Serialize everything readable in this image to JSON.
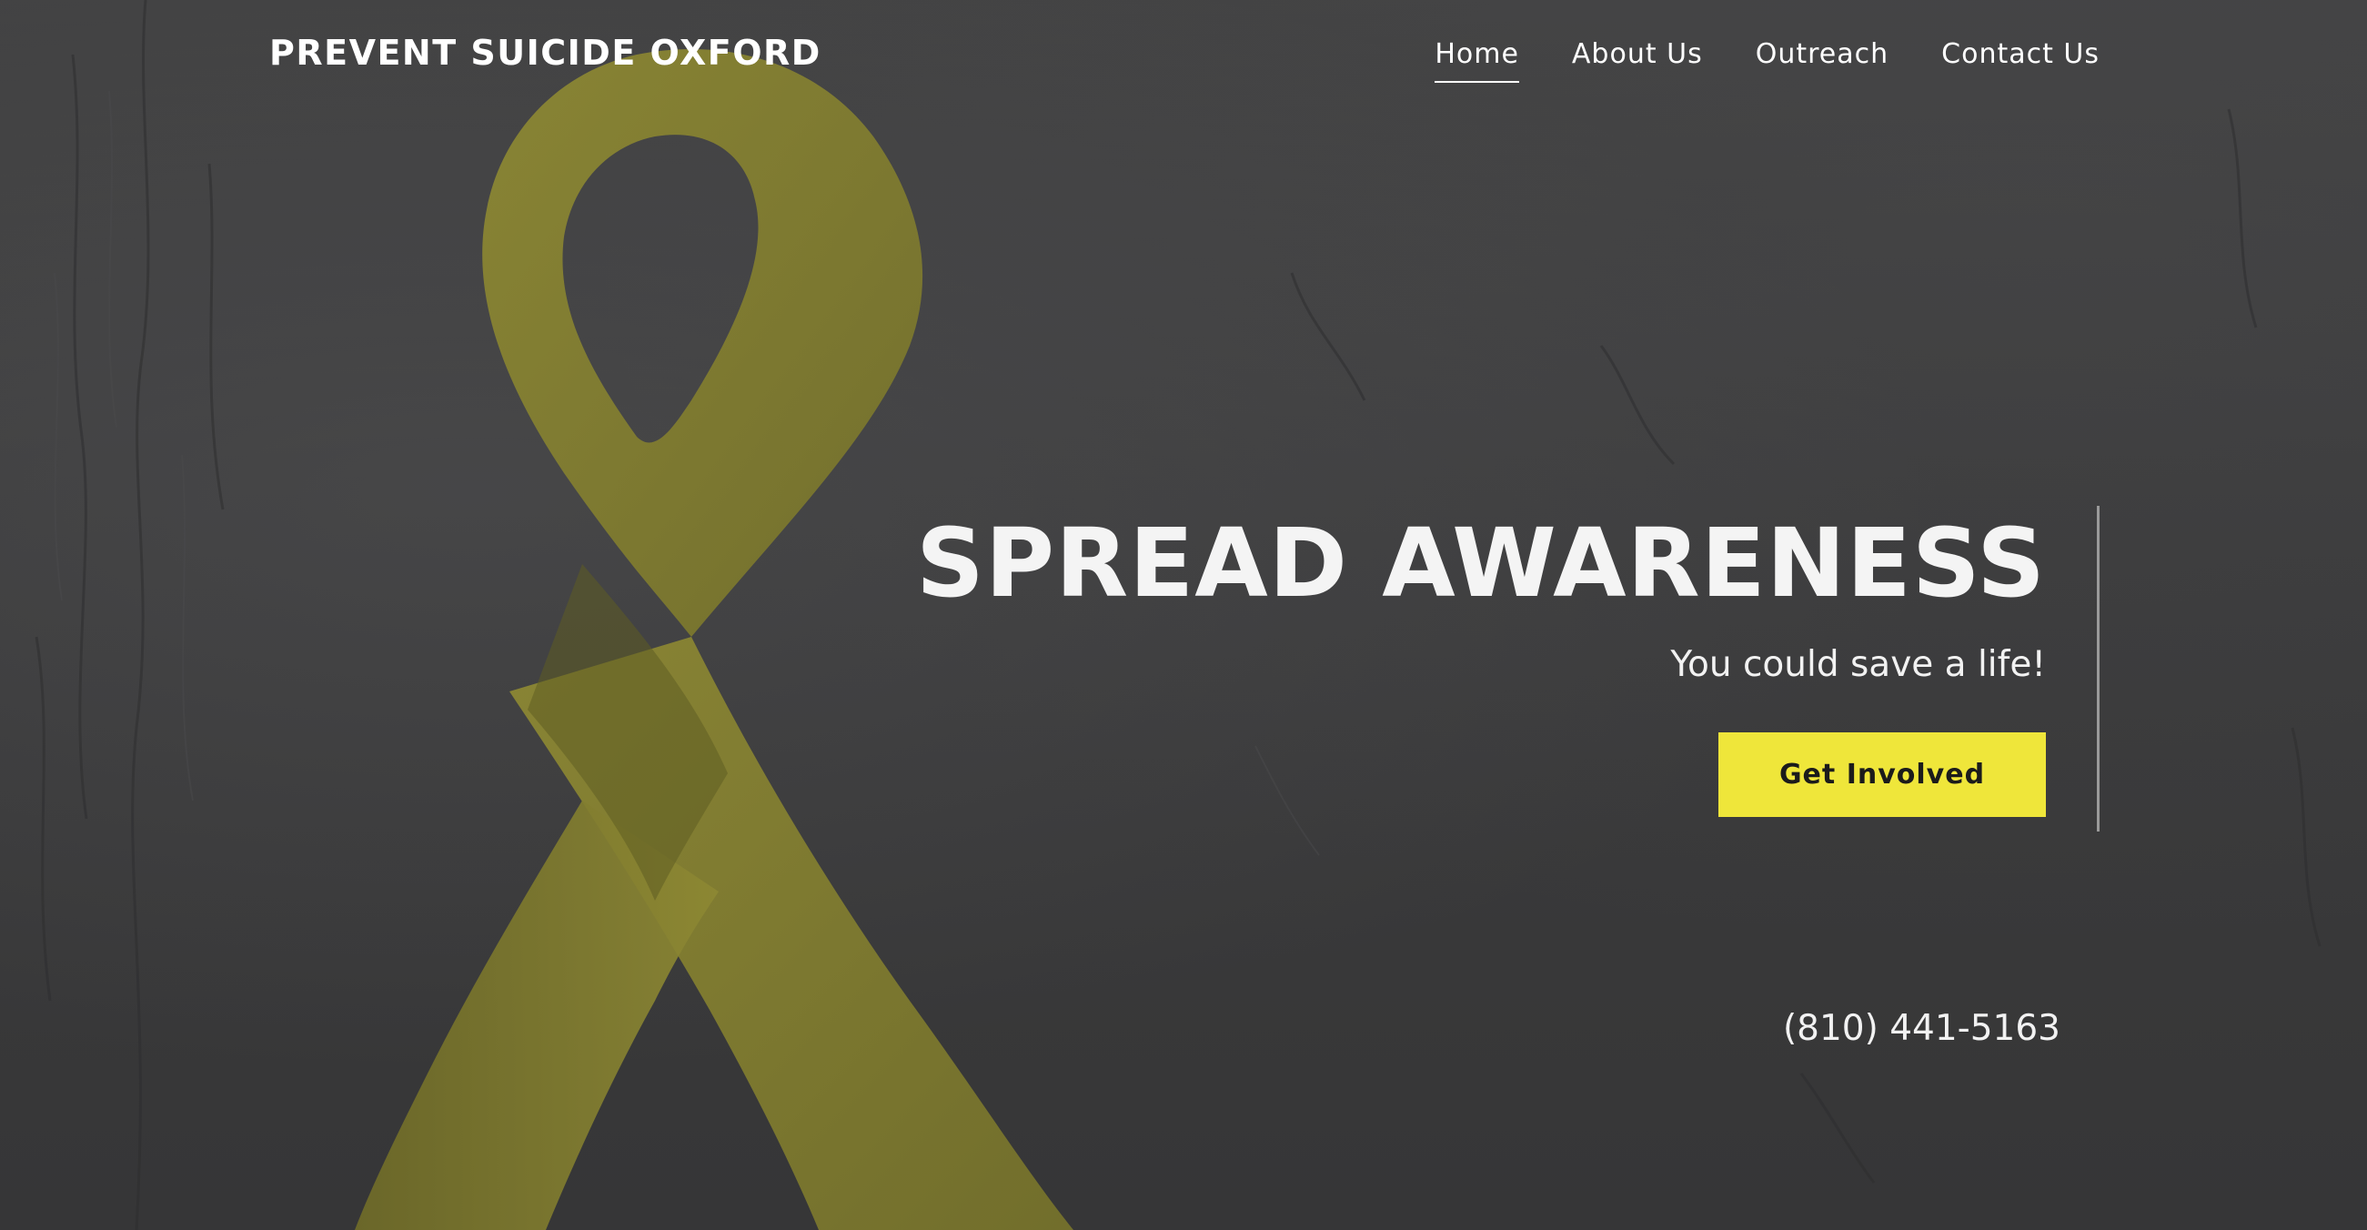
{
  "site": {
    "brand": "PREVENT SUICIDE OXFORD"
  },
  "nav": {
    "items": [
      {
        "label": "Home",
        "active": true
      },
      {
        "label": "About Us",
        "active": false
      },
      {
        "label": "Outreach",
        "active": false
      },
      {
        "label": "Contact Us",
        "active": false
      }
    ]
  },
  "hero": {
    "title": "SPREAD AWARENESS",
    "subtitle": "You could save a life!",
    "cta_label": "Get Involved"
  },
  "contact": {
    "phone": "(810) 441-5163"
  },
  "colors": {
    "background": "#3a3a3b",
    "accent": "#efe63a",
    "ribbon": "#8a8531",
    "text": "#ffffff"
  },
  "background_image": {
    "icon": "awareness-ribbon-icon"
  }
}
